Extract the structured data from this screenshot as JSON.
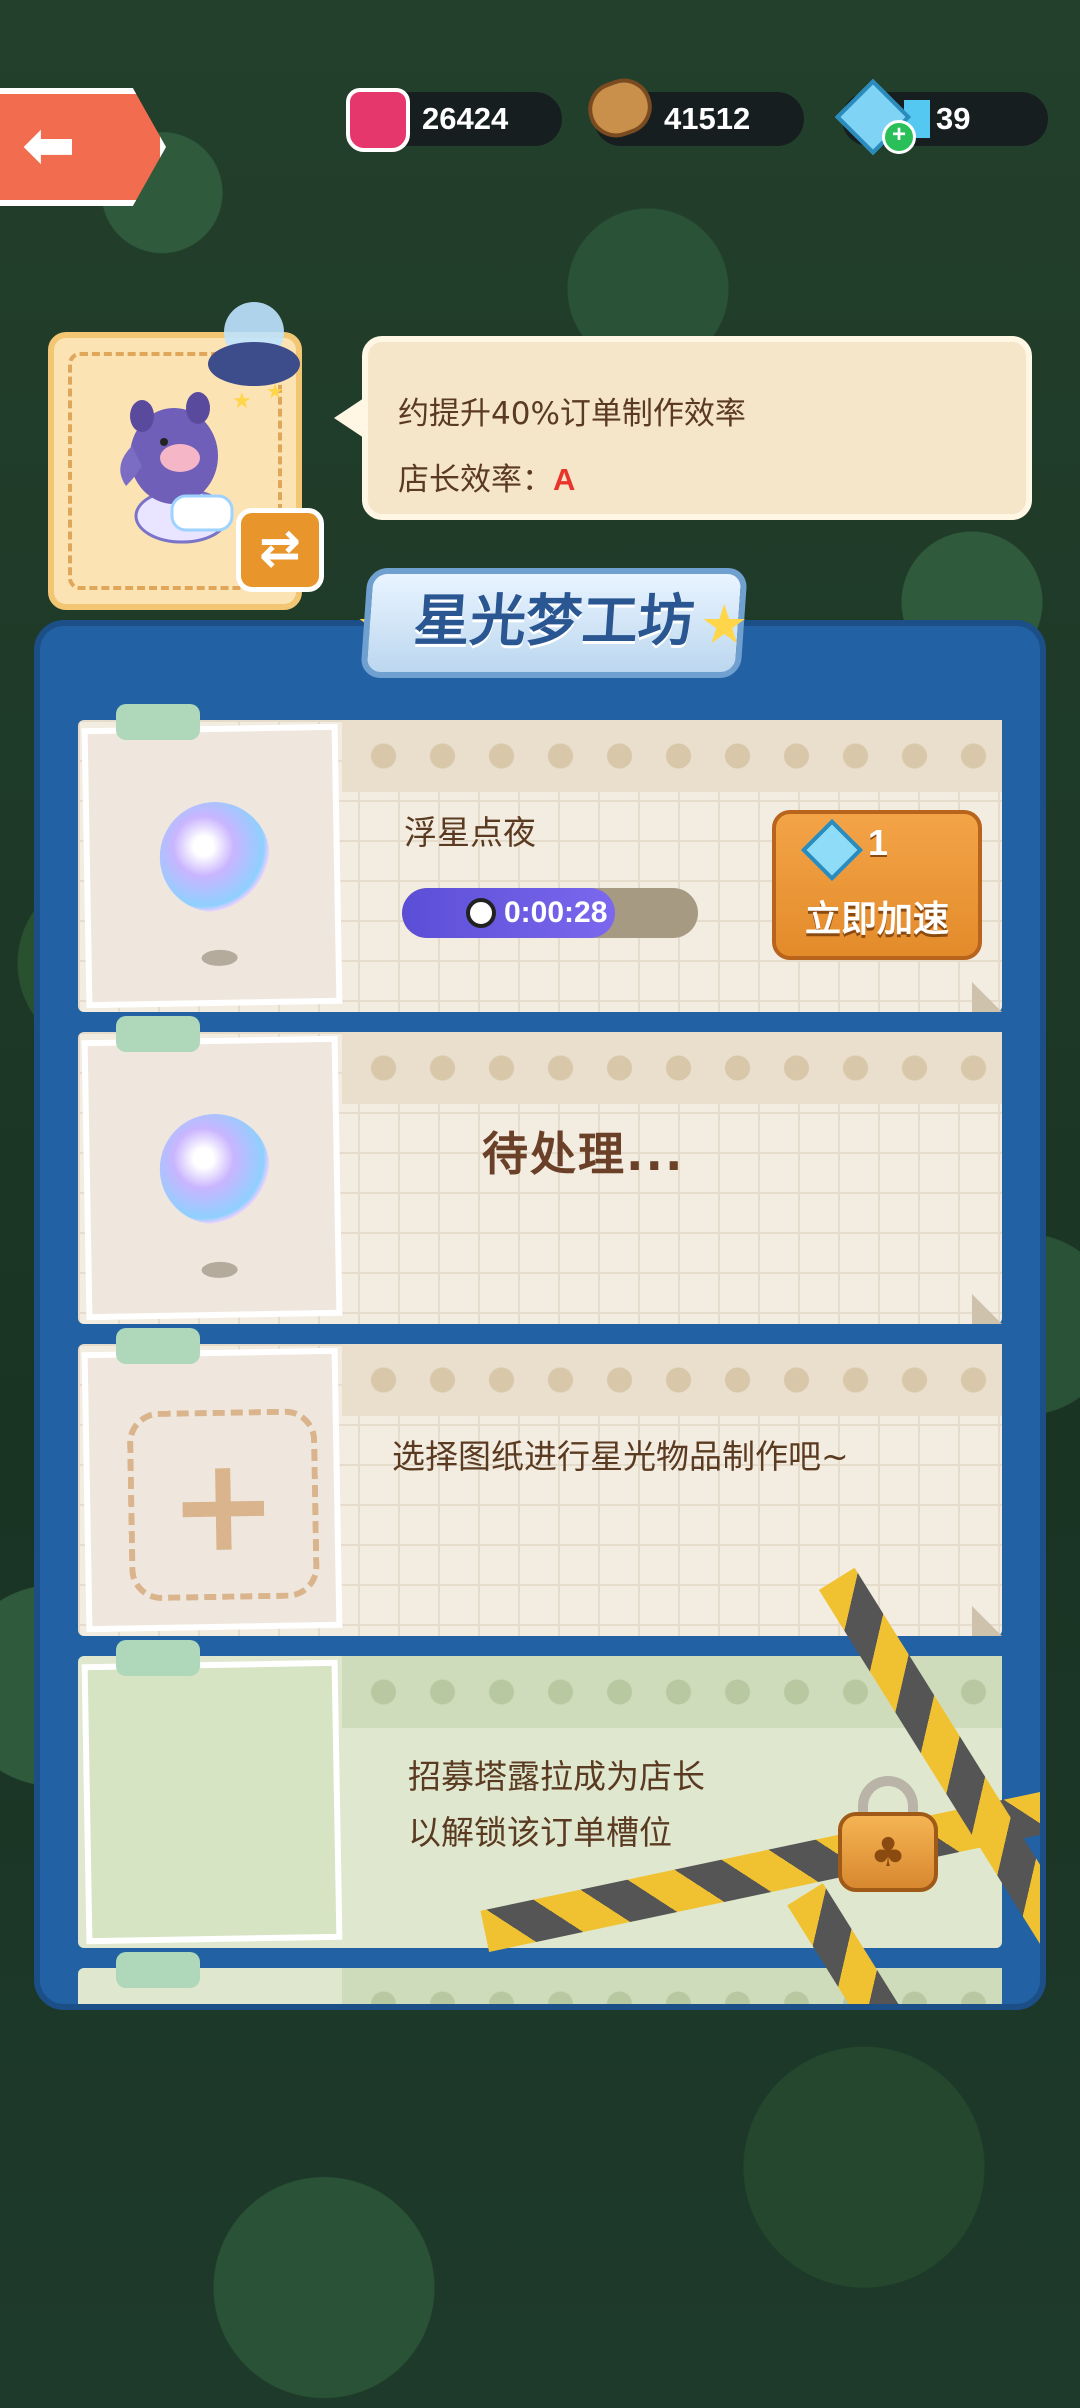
{
  "resources": {
    "ink": "26424",
    "wood": "41512",
    "gems": "39"
  },
  "manager": {
    "bonus_text": "约提升40%订单制作效率",
    "efficiency_label": "店长效率：",
    "efficiency_grade": "A",
    "swap_icon": "⇄"
  },
  "workshop": {
    "title": "星光梦工坊"
  },
  "slots": [
    {
      "item_name": "浮星点夜",
      "timer": "0:00:28",
      "progress": 0.72,
      "speed_cost": "1",
      "speed_label": "立即加速"
    },
    {
      "status": "待处理..."
    },
    {
      "prompt": "选择图纸进行星光物品制作吧~"
    },
    {
      "lock_line1": "招募塔露拉成为店长",
      "lock_line2": "以解锁该订单槽位"
    }
  ],
  "icons": {
    "back": "back-arrow-icon",
    "ink": "ink-jar-icon",
    "wood": "wood-log-icon",
    "gem": "gem-icon",
    "clock": "clock-icon",
    "lock": "lock-icon"
  },
  "colors": {
    "panel": "#2261a3",
    "accent_orange": "#e8962c",
    "grade_red": "#e8342a"
  }
}
